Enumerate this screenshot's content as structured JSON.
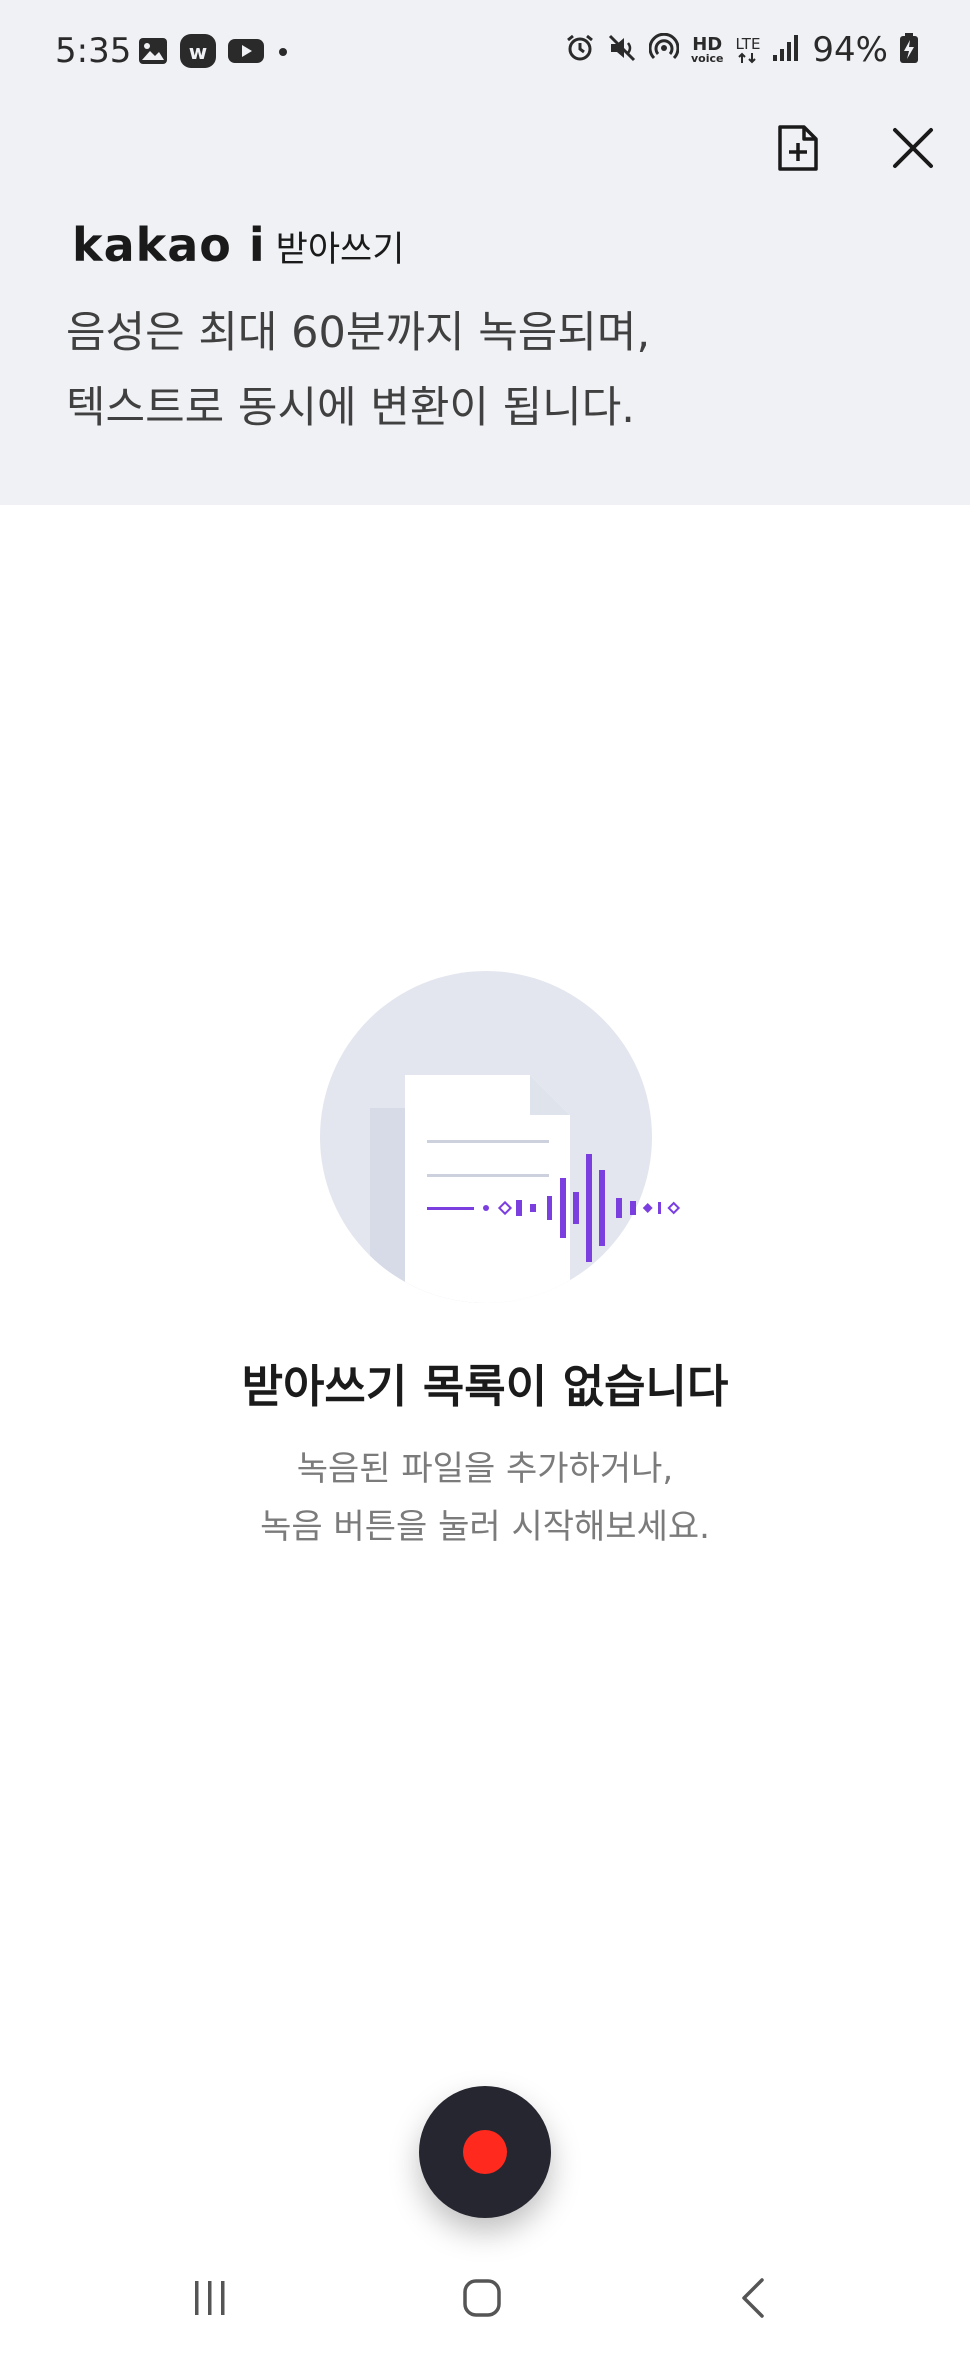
{
  "status_bar": {
    "time": "5:35",
    "notification_icons": [
      "gallery-icon",
      "w-app-icon",
      "youtube-icon",
      "more-dot-icon"
    ],
    "right_icons": [
      "alarm-icon",
      "mute-icon",
      "hotspot-icon",
      "hd-voice-icon",
      "lte-icon",
      "signal-icon"
    ],
    "hd_top": "HD",
    "hd_bottom": "voice",
    "lte_label": "LTE",
    "battery_text": "94%"
  },
  "header": {
    "brand_logo": "kakao i",
    "brand_sub": "받아쓰기",
    "intro_line1": "음성은 최대 60분까지 녹음되며,",
    "intro_line2": "텍스트로 동시에 변환이 됩니다."
  },
  "actions": {
    "add_file_icon": "add-file-icon",
    "close_icon": "close-icon"
  },
  "empty_state": {
    "title": "받아쓰기 목록이 없습니다",
    "desc_line1": "녹음된 파일을 추가하거나,",
    "desc_line2": "녹음 버튼을 눌러 시작해보세요."
  },
  "colors": {
    "header_bg": "#f0f1f5",
    "accent_purple": "#7b3fe0",
    "record_red": "#ff2a1d",
    "record_bg": "#262630"
  },
  "nav_bar": {
    "icons": [
      "recent-apps-icon",
      "home-icon",
      "back-icon"
    ]
  }
}
